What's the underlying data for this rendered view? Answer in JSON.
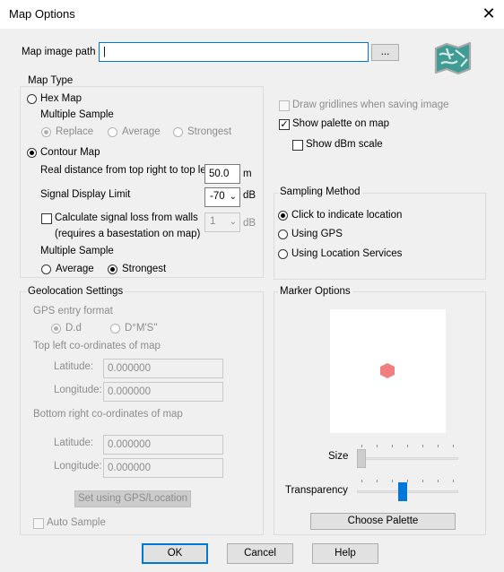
{
  "window": {
    "title": "Map Options",
    "close_glyph": "✕"
  },
  "map_image_path": {
    "label": "Map image path",
    "value": "|",
    "browse_label": "..."
  },
  "map_type": {
    "legend": "Map Type",
    "hex_map": {
      "label": "Hex Map",
      "checked": false
    },
    "hex_multiple_sample": {
      "label": "Multiple Sample",
      "options": [
        "Replace",
        "Average",
        "Strongest"
      ],
      "selected": "Replace"
    },
    "contour_map": {
      "label": "Contour Map",
      "checked": true
    },
    "real_distance": {
      "label": "Real distance from top right to top left",
      "value": "50.0",
      "unit": "m"
    },
    "signal_display_limit": {
      "label": "Signal Display Limit",
      "value": "-70",
      "unit": "dB"
    },
    "calc_signal_loss": {
      "label_line1": "Calculate signal loss from walls",
      "label_line2": "(requires a basestation on map)",
      "checked": false,
      "value": "1",
      "unit": "dB"
    },
    "contour_multiple_sample": {
      "label": "Multiple Sample",
      "options": [
        "Average",
        "Strongest"
      ],
      "selected": "Strongest"
    }
  },
  "right_options": {
    "draw_gridlines": {
      "label": "Draw gridlines when saving image",
      "checked": false
    },
    "show_palette": {
      "label": "Show palette on map",
      "checked": true
    },
    "show_dbm_scale": {
      "label": "Show dBm scale",
      "checked": false
    }
  },
  "sampling_method": {
    "legend": "Sampling Method",
    "options": [
      "Click to indicate location",
      "Using GPS",
      "Using Location Services"
    ],
    "selected": "Click to indicate location"
  },
  "geolocation": {
    "legend": "Geolocation Settings",
    "gps_entry_format": {
      "label": "GPS entry format",
      "options": [
        "D.d",
        "D°M'S''"
      ],
      "selected": "D.d"
    },
    "top_left_label": "Top left co-ordinates of map",
    "bottom_right_label": "Bottom right  co-ordinates of map",
    "top_left": {
      "latitude_label": "Latitude:",
      "latitude": "0.000000",
      "longitude_label": "Longitude:",
      "longitude": "0.000000"
    },
    "bottom_right": {
      "latitude_label": "Latitude:",
      "latitude": "0.000000",
      "longitude_label": "Longitude:",
      "longitude": "0.000000"
    },
    "set_button": "Set using GPS/Location",
    "auto_sample": {
      "label": "Auto Sample",
      "checked": false
    }
  },
  "marker_options": {
    "legend": "Marker Options",
    "marker_color": "#f08080",
    "size_label": "Size",
    "size_value": 0.0,
    "transparency_label": "Transparency",
    "transparency_value": 0.45,
    "choose_palette": "Choose Palette"
  },
  "footer": {
    "ok": "OK",
    "cancel": "Cancel",
    "help": "Help"
  }
}
